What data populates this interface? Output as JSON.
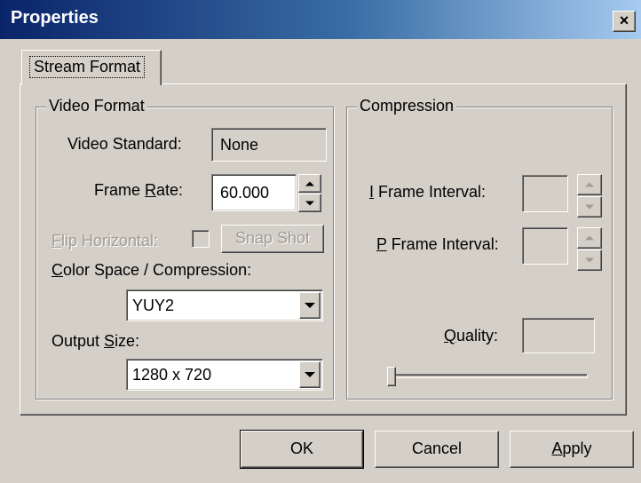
{
  "window": {
    "title": "Properties",
    "close_glyph": "×"
  },
  "tabs": [
    {
      "label": "Stream Format",
      "active": true
    }
  ],
  "video_format": {
    "group_title": "Video Format",
    "video_standard": {
      "label": "Video Standard:",
      "value": "None"
    },
    "frame_rate": {
      "label_pre": "Frame ",
      "label_u": "R",
      "label_post": "ate:",
      "value": "60.000"
    },
    "flip_horizontal": {
      "label_u": "F",
      "label_post": "lip Horizontal:",
      "checked": false,
      "enabled": false
    },
    "snap_shot": {
      "label": "Snap Shot",
      "enabled": false
    },
    "color_space": {
      "label_u": "C",
      "label_post": "olor Space / Compression:",
      "selected": "YUY2"
    },
    "output_size": {
      "label_pre": "Output ",
      "label_u": "S",
      "label_post": "ize:",
      "selected": "1280 x 720"
    }
  },
  "compression": {
    "group_title": "Compression",
    "i_frame": {
      "label_u": "I",
      "label_post": " Frame Interval:",
      "value": "",
      "enabled": false
    },
    "p_frame": {
      "label_u": "P",
      "label_post": " Frame Interval:",
      "value": "",
      "enabled": false
    },
    "quality": {
      "label_u": "Q",
      "label_post": "uality:",
      "value": "",
      "slider_level": 0
    }
  },
  "buttons": {
    "ok": "OK",
    "cancel": "Cancel",
    "apply_u": "A",
    "apply_post": "pply"
  },
  "colors": {
    "dialog_bg": "#d4d0c8",
    "titlebar_start": "#0a246a",
    "titlebar_end": "#a6caf0",
    "disabled_text": "#a09c94"
  },
  "icons": [
    "close-icon",
    "spin-up-icon",
    "spin-down-icon",
    "dropdown-arrow-icon"
  ]
}
